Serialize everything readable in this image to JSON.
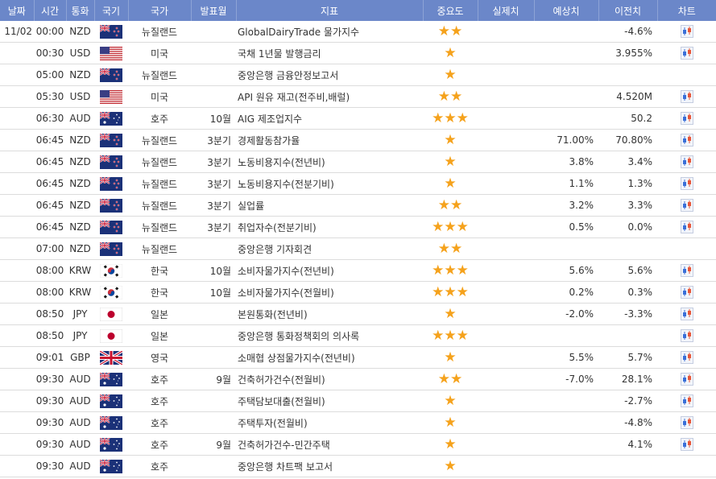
{
  "header": {
    "date": "날짜",
    "time": "시간",
    "currency": "통화",
    "flag": "국기",
    "country": "국가",
    "period": "발표월",
    "indicator": "지표",
    "importance": "중요도",
    "actual": "실제치",
    "forecast": "예상치",
    "previous": "이전치",
    "chart": "차트"
  },
  "colors": {
    "header_bg": "#6b87c9",
    "star": "#f5a21c",
    "row_border": "#dcdcdc"
  },
  "rows": [
    {
      "date": "11/02",
      "time": "00:00",
      "currency": "NZD",
      "flag": "nz-flag-icon",
      "country": "뉴질랜드",
      "period": "",
      "indicator": "GlobalDairyTrade 물가지수",
      "stars": "★★",
      "actual": "",
      "forecast": "",
      "previous": "-4.6%"
    },
    {
      "date": "",
      "time": "00:30",
      "currency": "USD",
      "flag": "us-flag-icon",
      "country": "미국",
      "period": "",
      "indicator": "국채 1년물 발행금리",
      "stars": "★",
      "actual": "",
      "forecast": "",
      "previous": "3.955%"
    },
    {
      "date": "",
      "time": "05:00",
      "currency": "NZD",
      "flag": "nz-flag-icon",
      "country": "뉴질랜드",
      "period": "",
      "indicator": "중앙은행 금융안정보고서",
      "stars": "★",
      "actual": "",
      "forecast": "",
      "previous": ""
    },
    {
      "date": "",
      "time": "05:30",
      "currency": "USD",
      "flag": "us-flag-icon",
      "country": "미국",
      "period": "",
      "indicator": "API 원유 재고(전주비,배럴)",
      "stars": "★★",
      "actual": "",
      "forecast": "",
      "previous": "4.520M"
    },
    {
      "date": "",
      "time": "06:30",
      "currency": "AUD",
      "flag": "au-flag-icon",
      "country": "호주",
      "period": "10월",
      "indicator": "AIG 제조업지수",
      "stars": "★★★",
      "actual": "",
      "forecast": "",
      "previous": "50.2"
    },
    {
      "date": "",
      "time": "06:45",
      "currency": "NZD",
      "flag": "nz-flag-icon",
      "country": "뉴질랜드",
      "period": "3분기",
      "indicator": "경제활동참가율",
      "stars": "★",
      "actual": "",
      "forecast": "71.00%",
      "previous": "70.80%"
    },
    {
      "date": "",
      "time": "06:45",
      "currency": "NZD",
      "flag": "nz-flag-icon",
      "country": "뉴질랜드",
      "period": "3분기",
      "indicator": "노동비용지수(전년비)",
      "stars": "★",
      "actual": "",
      "forecast": "3.8%",
      "previous": "3.4%"
    },
    {
      "date": "",
      "time": "06:45",
      "currency": "NZD",
      "flag": "nz-flag-icon",
      "country": "뉴질랜드",
      "period": "3분기",
      "indicator": "노동비용지수(전분기비)",
      "stars": "★",
      "actual": "",
      "forecast": "1.1%",
      "previous": "1.3%"
    },
    {
      "date": "",
      "time": "06:45",
      "currency": "NZD",
      "flag": "nz-flag-icon",
      "country": "뉴질랜드",
      "period": "3분기",
      "indicator": "실업률",
      "stars": "★★",
      "actual": "",
      "forecast": "3.2%",
      "previous": "3.3%"
    },
    {
      "date": "",
      "time": "06:45",
      "currency": "NZD",
      "flag": "nz-flag-icon",
      "country": "뉴질랜드",
      "period": "3분기",
      "indicator": "취업자수(전분기비)",
      "stars": "★★★",
      "actual": "",
      "forecast": "0.5%",
      "previous": "0.0%"
    },
    {
      "date": "",
      "time": "07:00",
      "currency": "NZD",
      "flag": "nz-flag-icon",
      "country": "뉴질랜드",
      "period": "",
      "indicator": "중앙은행 기자회견",
      "stars": "★★",
      "actual": "",
      "forecast": "",
      "previous": ""
    },
    {
      "date": "",
      "time": "08:00",
      "currency": "KRW",
      "flag": "kr-flag-icon",
      "country": "한국",
      "period": "10월",
      "indicator": "소비자물가지수(전년비)",
      "stars": "★★★",
      "actual": "",
      "forecast": "5.6%",
      "previous": "5.6%"
    },
    {
      "date": "",
      "time": "08:00",
      "currency": "KRW",
      "flag": "kr-flag-icon",
      "country": "한국",
      "period": "10월",
      "indicator": "소비자물가지수(전월비)",
      "stars": "★★★",
      "actual": "",
      "forecast": "0.2%",
      "previous": "0.3%"
    },
    {
      "date": "",
      "time": "08:50",
      "currency": "JPY",
      "flag": "jp-flag-icon",
      "country": "일본",
      "period": "",
      "indicator": "본원통화(전년비)",
      "stars": "★",
      "actual": "",
      "forecast": "-2.0%",
      "previous": "-3.3%"
    },
    {
      "date": "",
      "time": "08:50",
      "currency": "JPY",
      "flag": "jp-flag-icon",
      "country": "일본",
      "period": "",
      "indicator": "중앙은행 통화정책회의 의사록",
      "stars": "★★★",
      "actual": "",
      "forecast": "",
      "previous": ""
    },
    {
      "date": "",
      "time": "09:01",
      "currency": "GBP",
      "flag": "gb-flag-icon",
      "country": "영국",
      "period": "",
      "indicator": "소매협 상점물가지수(전년비)",
      "stars": "★",
      "actual": "",
      "forecast": "5.5%",
      "previous": "5.7%"
    },
    {
      "date": "",
      "time": "09:30",
      "currency": "AUD",
      "flag": "au-flag-icon",
      "country": "호주",
      "period": "9월",
      "indicator": "건축허가건수(전월비)",
      "stars": "★★",
      "actual": "",
      "forecast": "-7.0%",
      "previous": "28.1%"
    },
    {
      "date": "",
      "time": "09:30",
      "currency": "AUD",
      "flag": "au-flag-icon",
      "country": "호주",
      "period": "",
      "indicator": "주택담보대출(전월비)",
      "stars": "★",
      "actual": "",
      "forecast": "",
      "previous": "-2.7%"
    },
    {
      "date": "",
      "time": "09:30",
      "currency": "AUD",
      "flag": "au-flag-icon",
      "country": "호주",
      "period": "",
      "indicator": "주택투자(전월비)",
      "stars": "★",
      "actual": "",
      "forecast": "",
      "previous": "-4.8%"
    },
    {
      "date": "",
      "time": "09:30",
      "currency": "AUD",
      "flag": "au-flag-icon",
      "country": "호주",
      "period": "9월",
      "indicator": "건축허가건수-민간주택",
      "stars": "★",
      "actual": "",
      "forecast": "",
      "previous": "4.1%"
    },
    {
      "date": "",
      "time": "09:30",
      "currency": "AUD",
      "flag": "au-flag-icon",
      "country": "호주",
      "period": "",
      "indicator": "중앙은행 차트팩 보고서",
      "stars": "★",
      "actual": "",
      "forecast": "",
      "previous": ""
    }
  ],
  "chart_rows": [
    true,
    true,
    false,
    true,
    true,
    true,
    true,
    true,
    true,
    true,
    false,
    true,
    true,
    true,
    true,
    true,
    true,
    true,
    true,
    true,
    false
  ]
}
